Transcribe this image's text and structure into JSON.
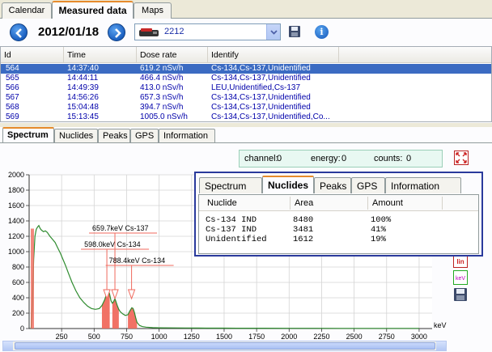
{
  "top_tabs": [
    "Calendar",
    "Measured data",
    "Maps"
  ],
  "toolbar": {
    "date": "2012/01/18",
    "device": "2212"
  },
  "table": {
    "headers": [
      "Id",
      "Time",
      "Dose rate",
      "Identify"
    ],
    "rows": [
      [
        "564",
        "14:37:40",
        "619.2 nSv/h",
        "Cs-134,Cs-137,Unidentified"
      ],
      [
        "565",
        "14:44:11",
        "466.4 nSv/h",
        "Cs-134,Cs-137,Unidentified"
      ],
      [
        "566",
        "14:49:39",
        "413.0 nSv/h",
        "LEU,Unidentified,Cs-137"
      ],
      [
        "567",
        "14:56:26",
        "657.3 nSv/h",
        "Cs-134,Cs-137,Unidentified"
      ],
      [
        "568",
        "15:04:48",
        "394.7 nSv/h",
        "Cs-134,Cs-137,Unidentified"
      ],
      [
        "569",
        "15:13:45",
        "1005.0 nSv/h",
        "Cs-134,Cs-137,Unidentified,Co..."
      ]
    ],
    "selected_row": 0
  },
  "bottom_tabs": [
    "Spectrum",
    "Nuclides",
    "Peaks",
    "GPS",
    "Information"
  ],
  "readout": {
    "channel_label": "channel:",
    "channel_value": "0",
    "energy_label": "energy:",
    "energy_value": "0",
    "counts_label": "counts:",
    "counts_value": "0"
  },
  "side_icons": [
    "expand-icon",
    "log-scale-icon",
    "kev-icon",
    "save-icon"
  ],
  "side_icon_text": {
    "lin": "lin",
    "kev": "keV"
  },
  "popup": {
    "tabs": [
      "Spectrum",
      "Nuclides",
      "Peaks",
      "GPS",
      "Information"
    ],
    "active_tab": 1,
    "headers": [
      "Nuclide",
      "Area",
      "Amount"
    ],
    "rows": [
      [
        "Cs-134 IND",
        "8480",
        "100%"
      ],
      [
        "Cs-137 IND",
        "3481",
        "41%"
      ],
      [
        "Unidentified",
        "1612",
        "19%"
      ]
    ]
  },
  "chart_data": {
    "type": "line",
    "ylabel": "cnts",
    "xlabel": "keV",
    "xlim": [
      0,
      3100
    ],
    "ylim": [
      0,
      2000
    ],
    "x_ticks": [
      250,
      500,
      750,
      1000,
      1250,
      1500,
      1750,
      2000,
      2250,
      2500,
      2750,
      3000
    ],
    "y_ticks": [
      0,
      200,
      400,
      600,
      800,
      1000,
      1200,
      1400,
      1600,
      1800,
      2000
    ],
    "grid": true,
    "series": [
      {
        "color": "#2e8b2e",
        "x": [
          15,
          25,
          35,
          45,
          55,
          65,
          75,
          85,
          95,
          110,
          125,
          140,
          160,
          180,
          200,
          220,
          240,
          260,
          280,
          300,
          330,
          360,
          390,
          420,
          450,
          480,
          510,
          540,
          560,
          580,
          590,
          600,
          610,
          620,
          630,
          640,
          650,
          660,
          670,
          680,
          690,
          700,
          720,
          740,
          760,
          775,
          790,
          800,
          810,
          820,
          830,
          850,
          870,
          900,
          950,
          1000,
          1100,
          1200,
          1300,
          1400,
          1500,
          1600,
          1800,
          2000,
          2200,
          2400,
          2600,
          2800,
          3000
        ],
        "values": [
          0,
          300,
          900,
          1200,
          1290,
          1320,
          1340,
          1300,
          1280,
          1260,
          1270,
          1250,
          1200,
          1160,
          1120,
          1050,
          980,
          900,
          820,
          730,
          600,
          490,
          400,
          340,
          290,
          260,
          250,
          260,
          300,
          370,
          420,
          470,
          500,
          440,
          360,
          330,
          350,
          390,
          340,
          290,
          250,
          220,
          190,
          170,
          180,
          230,
          270,
          260,
          210,
          140,
          80,
          40,
          25,
          18,
          12,
          10,
          8,
          7,
          6,
          5,
          5,
          4,
          4,
          3,
          3,
          2,
          2,
          2,
          2
        ]
      }
    ],
    "peaks": [
      {
        "label": "598.0keV Cs-134",
        "energy": 598,
        "from": 560,
        "to": 625
      },
      {
        "label": "659.7keV Cs-137",
        "energy": 660,
        "from": 640,
        "to": 690
      },
      {
        "label": "788.4keV Cs-134",
        "energy": 788,
        "from": 755,
        "to": 840
      }
    ],
    "roi_color": "#f06a5e"
  }
}
